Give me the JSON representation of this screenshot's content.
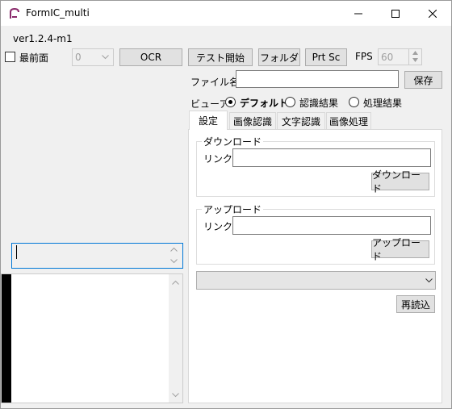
{
  "window": {
    "title": "FormIC_multi",
    "controls": [
      "minimize",
      "maximize",
      "close"
    ]
  },
  "version": "ver1.2.4-m1",
  "toolbar": {
    "topmost_label": "最前面",
    "topmost_checked": false,
    "camera_select_value": "0",
    "ocr_label": "OCR",
    "test_start_label": "テスト開始",
    "folder_label": "フォルダ",
    "prtsc_label": "Prt Sc",
    "fps_label": "FPS",
    "fps_value": "60"
  },
  "file": {
    "label": "ファイル名",
    "value": "",
    "save_label": "保存"
  },
  "viewer": {
    "label": "ビューア",
    "options": [
      {
        "label": "デフォルト",
        "selected": true
      },
      {
        "label": "認識結果",
        "selected": false
      },
      {
        "label": "処理結果",
        "selected": false
      }
    ]
  },
  "tabs": [
    {
      "label": "設定",
      "active": true
    },
    {
      "label": "画像認識",
      "active": false
    },
    {
      "label": "文字認識",
      "active": false
    },
    {
      "label": "画像処理",
      "active": false
    }
  ],
  "download": {
    "group_title": "ダウンロード",
    "link_label": "リンク",
    "link_value": "",
    "button_label": "ダウンロード"
  },
  "upload": {
    "group_title": "アップロード",
    "link_label": "リンク",
    "link_value": "",
    "button_label": "アップロード"
  },
  "settings": {
    "dropdown_value": "",
    "reload_label": "再読込"
  },
  "colors": {
    "accent": "#0078d7",
    "window_bg": "#f0f0f0",
    "button_bg": "#e1e1e1",
    "button_border": "#adadad",
    "disabled_text": "#a0a0a0"
  }
}
